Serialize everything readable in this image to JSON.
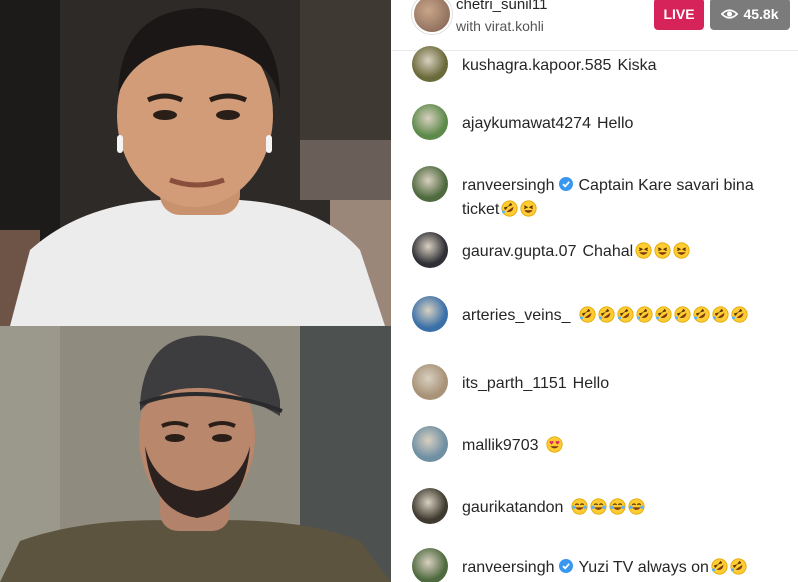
{
  "stream": {
    "host_username": "chetri_sunil11",
    "with_label": "with virat.kohli",
    "live_label": "LIVE",
    "viewer_icon": "eye-icon",
    "viewer_count": "45.8k",
    "colors": {
      "live": "#d6245a",
      "viewer_badge": "#7b7b7b",
      "verified": "#3897f0"
    }
  },
  "videos": [
    {
      "participant": "top",
      "description_icon": "participant-video"
    },
    {
      "participant": "bottom",
      "description_icon": "participant-video"
    }
  ],
  "comments": [
    {
      "username": "kushagra.kapoor.585",
      "text": "Kiska",
      "verified": false,
      "emojis": [],
      "avatar_color": "#6b6a3a"
    },
    {
      "username": "ajaykumawat4274",
      "text": "Hello",
      "verified": false,
      "emojis": [],
      "avatar_color": "#5d8a4a"
    },
    {
      "username": "ranveersingh",
      "text": "Captain Kare savari bina ticket",
      "verified": true,
      "emojis": [
        "rofl",
        "laugh"
      ],
      "avatar_color": "#4f6a3f"
    },
    {
      "username": "gaurav.gupta.07",
      "text": "Chahal",
      "verified": false,
      "emojis": [
        "laugh",
        "laugh",
        "laugh"
      ],
      "avatar_color": "#2f2f36"
    },
    {
      "username": "arteries_veins_",
      "text": "",
      "verified": false,
      "emojis": [
        "rofl",
        "rofl",
        "rofl",
        "rofl",
        "rofl",
        "rofl",
        "rofl",
        "rofl",
        "rofl"
      ],
      "avatar_color": "#3a70a8"
    },
    {
      "username": "its_parth_1151",
      "text": "Hello",
      "verified": false,
      "emojis": [],
      "avatar_color": "#a89378"
    },
    {
      "username": "mallik9703",
      "text": "",
      "verified": false,
      "emojis": [
        "heart-eyes"
      ],
      "avatar_color": "#6f8fa3"
    },
    {
      "username": "gaurikatandon",
      "text": "",
      "verified": false,
      "emojis": [
        "tears-joy",
        "tears-joy",
        "tears-joy",
        "tears-joy"
      ],
      "avatar_color": "#3e3a2f"
    },
    {
      "username": "ranveersingh",
      "text": "Yuzi TV always on",
      "verified": true,
      "emojis": [
        "rofl",
        "rofl"
      ],
      "avatar_color": "#4f6a3f"
    }
  ]
}
